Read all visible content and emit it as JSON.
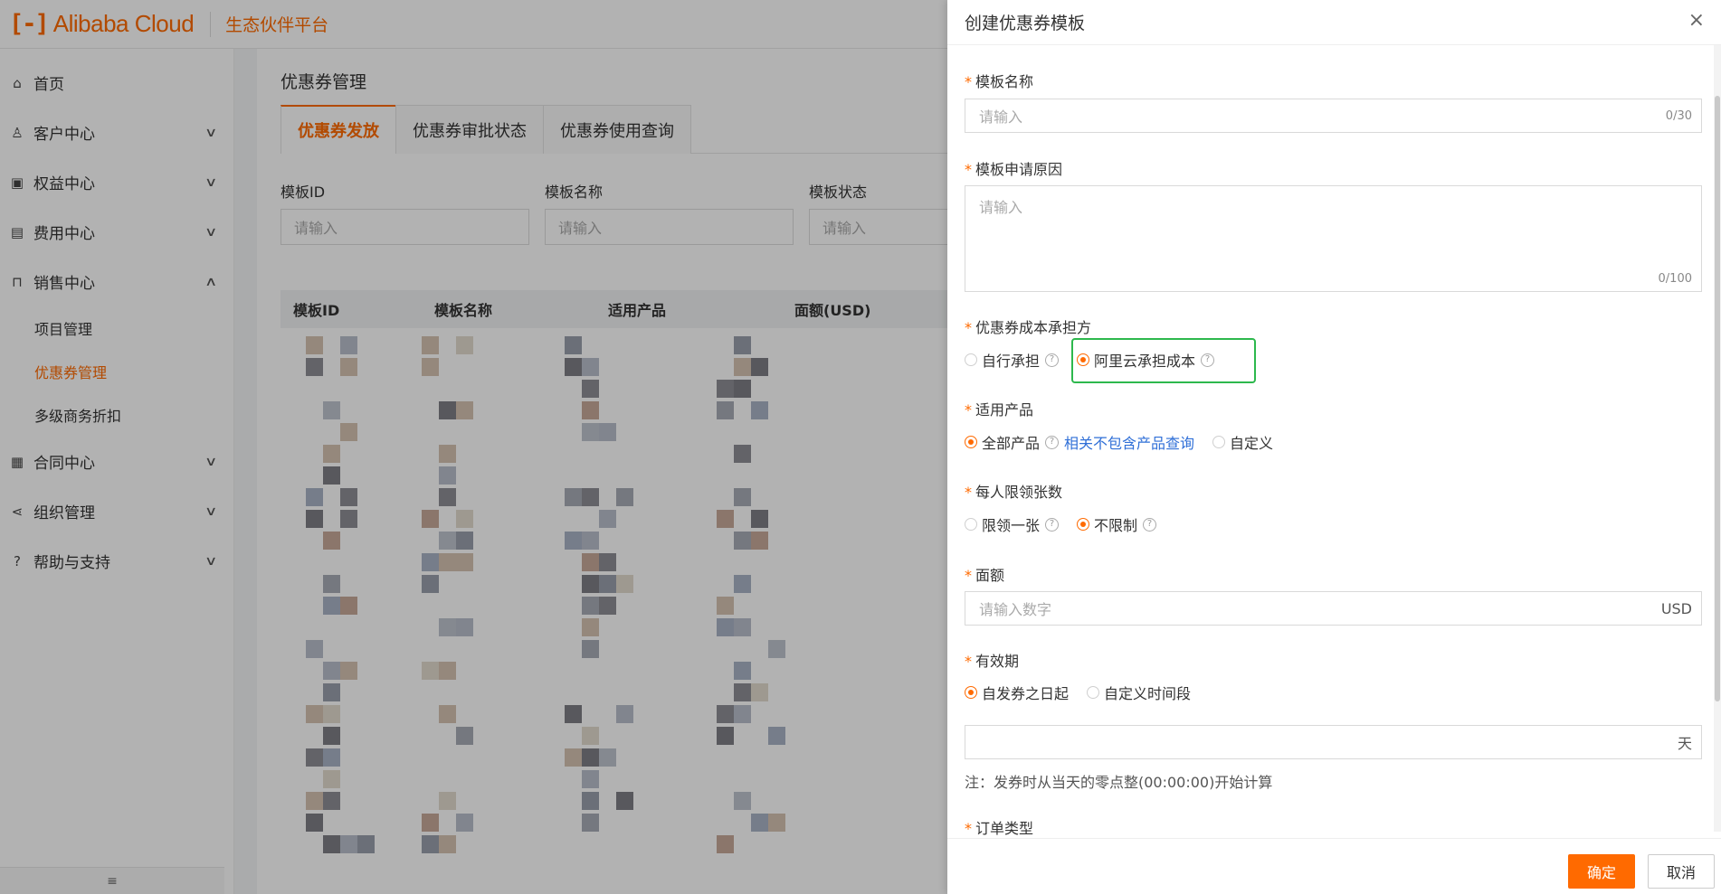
{
  "header": {
    "logo_mark": "[-]",
    "logo_text": "Alibaba Cloud",
    "subtitle": "生态伙伴平台"
  },
  "sidebar": {
    "items": [
      {
        "label": "首页",
        "icon": "home-icon",
        "glyph": "⌂",
        "expandable": false
      },
      {
        "label": "客户中心",
        "icon": "user-icon",
        "glyph": "♙",
        "expandable": true
      },
      {
        "label": "权益中心",
        "icon": "calendar-icon",
        "glyph": "▣",
        "expandable": true
      },
      {
        "label": "费用中心",
        "icon": "bill-icon",
        "glyph": "▤",
        "expandable": true
      },
      {
        "label": "销售中心",
        "icon": "bag-icon",
        "glyph": "⊓",
        "expandable": true,
        "expanded": true
      }
    ],
    "sub_items": [
      {
        "label": "项目管理",
        "active": false
      },
      {
        "label": "优惠券管理",
        "active": true
      },
      {
        "label": "多级商务折扣",
        "active": false
      }
    ],
    "items_after": [
      {
        "label": "合同中心",
        "icon": "contract-icon",
        "glyph": "▦",
        "expandable": true
      },
      {
        "label": "组织管理",
        "icon": "share-icon",
        "glyph": "⋖",
        "expandable": true
      },
      {
        "label": "帮助与支持",
        "icon": "help-circle-icon",
        "glyph": "?",
        "expandable": true
      }
    ],
    "footer_icon": "≡"
  },
  "main": {
    "page_title": "优惠券管理",
    "tabs": [
      {
        "label": "优惠券发放",
        "active": true
      },
      {
        "label": "优惠券审批状态",
        "active": false
      },
      {
        "label": "优惠券使用查询",
        "active": false
      }
    ],
    "filters": [
      {
        "label": "模板ID",
        "placeholder": "请输入"
      },
      {
        "label": "模板名称",
        "placeholder": "请输入"
      },
      {
        "label": "模板状态",
        "placeholder": "请输入"
      }
    ],
    "table_headers": [
      "模板ID",
      "模板名称",
      "适用产品",
      "面额(USD)"
    ]
  },
  "drawer": {
    "title": "创建优惠券模板",
    "close_icon": "×",
    "template_name": {
      "label": "模板名称",
      "placeholder": "请输入",
      "counter": "0/30"
    },
    "apply_reason": {
      "label": "模板申请原因",
      "placeholder": "请输入",
      "counter": "0/100"
    },
    "cost_bearer": {
      "label": "优惠券成本承担方",
      "options": [
        {
          "label": "自行承担",
          "selected": false
        },
        {
          "label": "阿里云承担成本",
          "selected": true
        }
      ]
    },
    "products": {
      "label": "适用产品",
      "option_all": "全部产品",
      "link": "相关不包含产品查询",
      "option_custom": "自定义"
    },
    "per_user_limit": {
      "label": "每人限领张数",
      "options": [
        {
          "label": "限领一张",
          "selected": false
        },
        {
          "label": "不限制",
          "selected": true
        }
      ]
    },
    "amount": {
      "label": "面额",
      "placeholder": "请输入数字",
      "suffix": "USD"
    },
    "validity": {
      "label": "有效期",
      "options": [
        {
          "label": "自发券之日起",
          "selected": true
        },
        {
          "label": "自定义时间段",
          "selected": false
        }
      ],
      "suffix": "天",
      "note": "注：发券时从当天的零点整(00:00:00)开始计算"
    },
    "order_type": {
      "label": "订单类型"
    },
    "buttons": {
      "confirm": "确定",
      "cancel": "取消"
    },
    "colors": {
      "accent": "#ff6a00",
      "highlight": "#2db84d",
      "link": "#2f6fd7"
    }
  }
}
